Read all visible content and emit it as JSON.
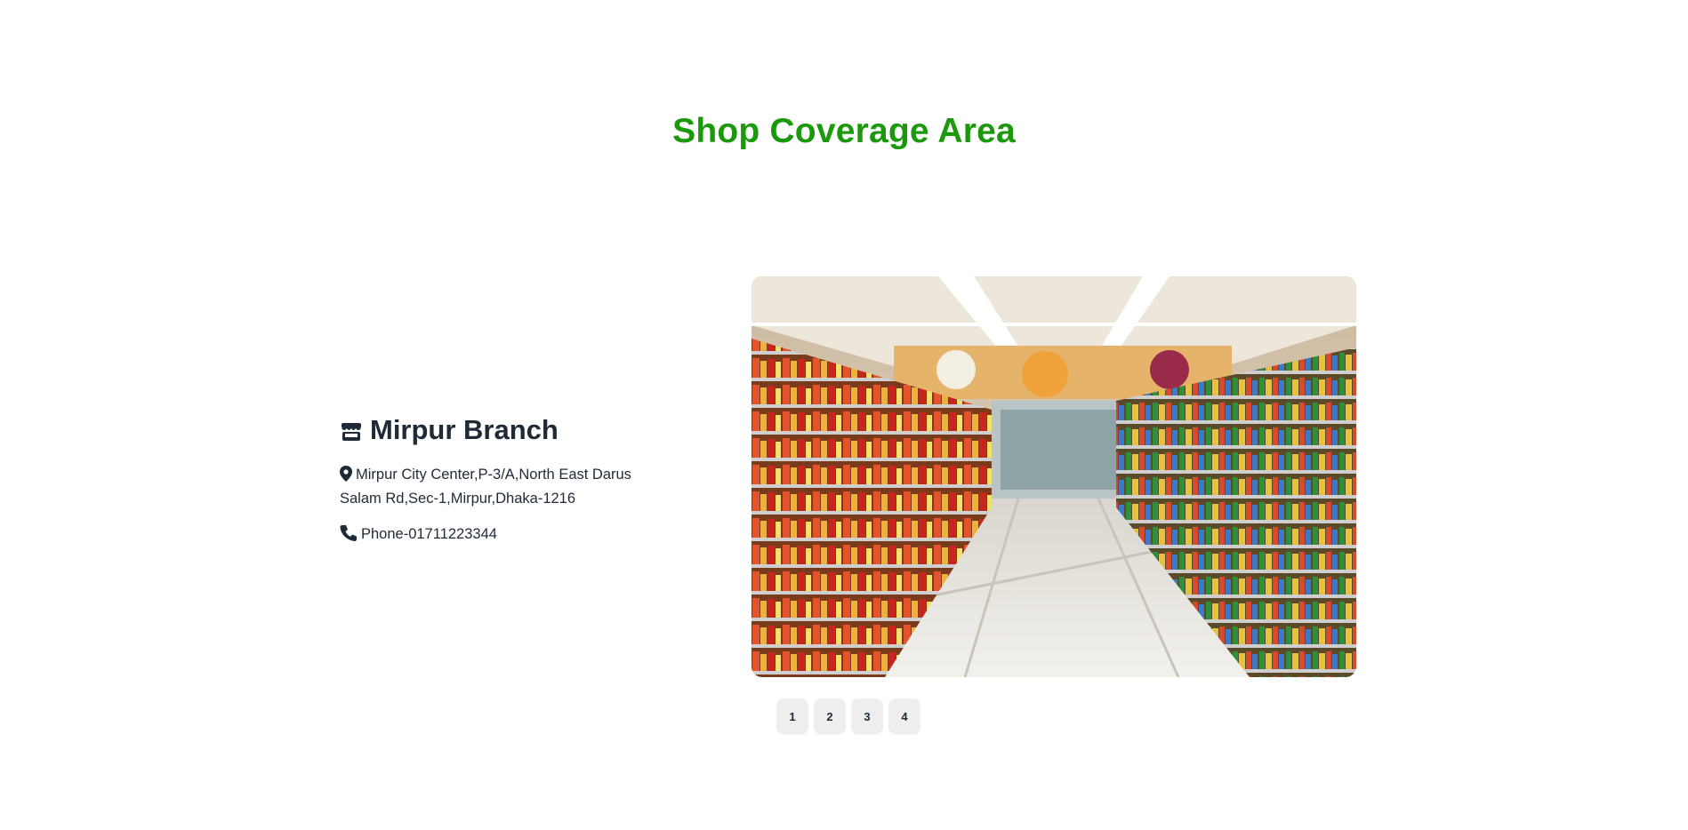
{
  "section": {
    "title": "Shop Coverage Area"
  },
  "branch": {
    "name": "Mirpur Branch",
    "icon": "store-icon",
    "address_line1": "Mirpur City Center,P-3/A,North East Darus",
    "address_line2": "Salam Rd,Sec-1,Mirpur,Dhaka-1216",
    "address_icon": "map-pin-icon",
    "phone": "Phone-01711223344",
    "phone_icon": "phone-icon"
  },
  "slider": {
    "image_alt": "Supermarket aisle with stocked shelves",
    "pages": [
      "1",
      "2",
      "3",
      "4"
    ]
  },
  "colors": {
    "title_green": "#1a9a0b",
    "text_dark": "#1f2a37",
    "pager_bg": "#eeeeee"
  }
}
